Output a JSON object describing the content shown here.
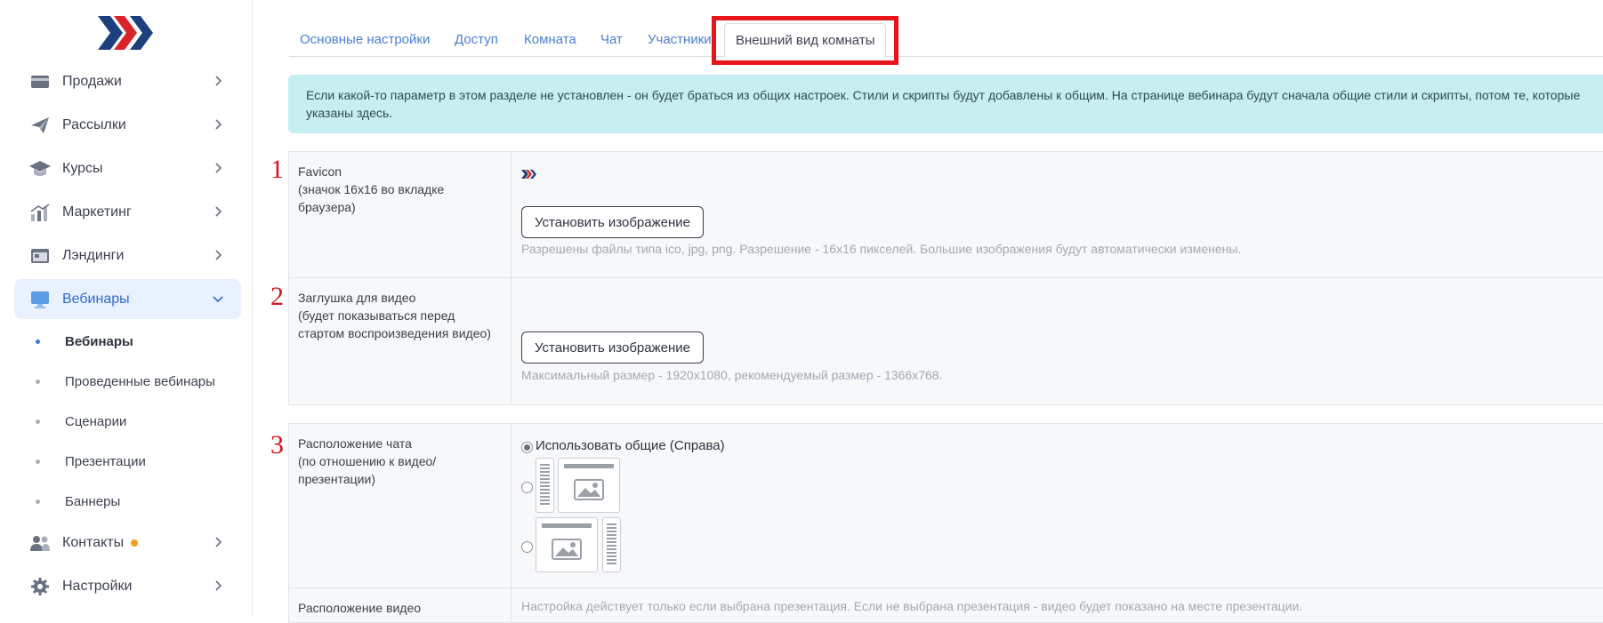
{
  "sidebar": {
    "items": [
      {
        "label": "Продажи",
        "icon": "wallet-icon"
      },
      {
        "label": "Рассылки",
        "icon": "paper-plane-icon"
      },
      {
        "label": "Курсы",
        "icon": "graduation-cap-icon"
      },
      {
        "label": "Маркетинг",
        "icon": "chart-icon"
      },
      {
        "label": "Лэндинги",
        "icon": "landing-page-icon"
      },
      {
        "label": "Вебинары",
        "icon": "monitor-icon"
      },
      {
        "label": "Контакты",
        "icon": "users-icon"
      },
      {
        "label": "Настройки",
        "icon": "gear-icon"
      }
    ],
    "subitems": [
      {
        "label": "Вебинары"
      },
      {
        "label": "Проведенные вебинары"
      },
      {
        "label": "Сценарии"
      },
      {
        "label": "Презентации"
      },
      {
        "label": "Баннеры"
      }
    ]
  },
  "tabs": [
    {
      "label": "Основные настройки"
    },
    {
      "label": "Доступ"
    },
    {
      "label": "Комната"
    },
    {
      "label": "Чат"
    },
    {
      "label": "Участники"
    },
    {
      "label": "Внешний вид комнаты"
    }
  ],
  "alert": "Если какой-то параметр в этом разделе не установлен - он будет браться из общих настроек. Стили и скрипты будут добавлены к общим. На странице вебинара будут сначала общие стили и скрипты, потом те, которые указаны здесь.",
  "annotations": [
    "1",
    "2",
    "3"
  ],
  "favicon": {
    "label": "Favicon",
    "sublabel": "(значок 16x16 во вкладке браузера)",
    "button": "Установить изображение",
    "hint": "Разрешены файлы типа ico, jpg, png. Разрешение - 16x16 пикселей. Большие изображения будут автоматически изменены."
  },
  "video_placeholder": {
    "label": "Заглушка для видео",
    "sublabel": "(будет показываться перед стартом воспроизведения видео)",
    "button": "Установить изображение",
    "hint": "Максимальный размер - 1920x1080, рекомендуемый размер - 1366x768."
  },
  "chat_position": {
    "label": "Расположение чата",
    "sublabel": "(по отношению к видео/ презентации)",
    "option_default": "Использовать общие (Справа)"
  },
  "video_position": {
    "label": "Расположение видео",
    "hint": "Настройка действует только если выбрана презентация. Если не выбрана презентация - видео будет показано на месте презентации."
  },
  "colors": {
    "accent": "#2e6bd3",
    "logo_dark": "#1c3f7d",
    "logo_red": "#d8232a",
    "highlight": "#e8141c"
  }
}
